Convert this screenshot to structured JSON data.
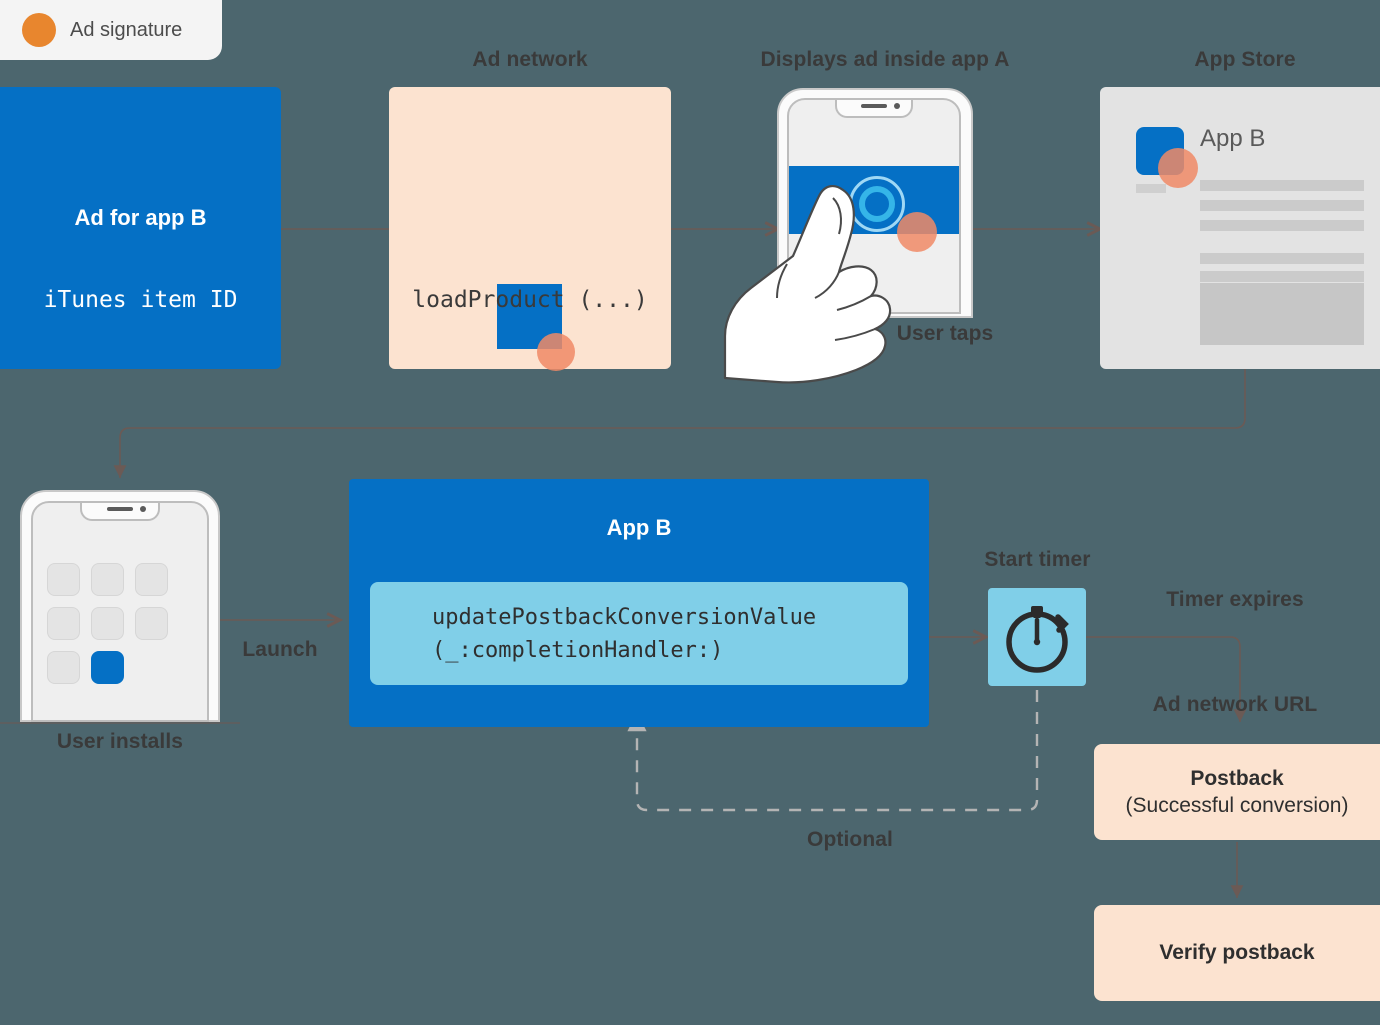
{
  "legend": {
    "label": "Ad signature",
    "dot_color": "#e8862e",
    "icon": "orange-circle-icon"
  },
  "colors": {
    "background": "#4c666e",
    "blue": "#0570c5",
    "light_blue": "#80cfe8",
    "peach": "#fce3d0",
    "grey": "#e3e3e3",
    "orange": "#e8862e",
    "signature_circle": "#f08a66",
    "connector": "#6b5a55",
    "caption": "#3a3a3a"
  },
  "captions": {
    "ad_network": "Ad network",
    "displays_ad": "Displays ad inside app A",
    "app_store": "App Store",
    "user_taps": "User taps",
    "user_installs": "User installs",
    "launch": "Launch",
    "start_timer": "Start timer",
    "timer_expires": "Timer expires",
    "ad_network_url": "Ad network URL",
    "optional": "Optional"
  },
  "ad_for_app_b": {
    "title": "Ad for app B",
    "subtitle": "iTunes item ID"
  },
  "ad_network_box": {
    "code": "loadProduct (...)"
  },
  "app_store_card": {
    "app_name": "App B"
  },
  "app_b": {
    "title": "App B",
    "code_line1": "updatePostbackConversionValue",
    "code_line2": "(_:completionHandler:)"
  },
  "timer": {
    "icon": "stopwatch-icon"
  },
  "postback": {
    "title": "Postback",
    "subtitle": "(Successful conversion)"
  },
  "verify": {
    "title": "Verify postback"
  }
}
